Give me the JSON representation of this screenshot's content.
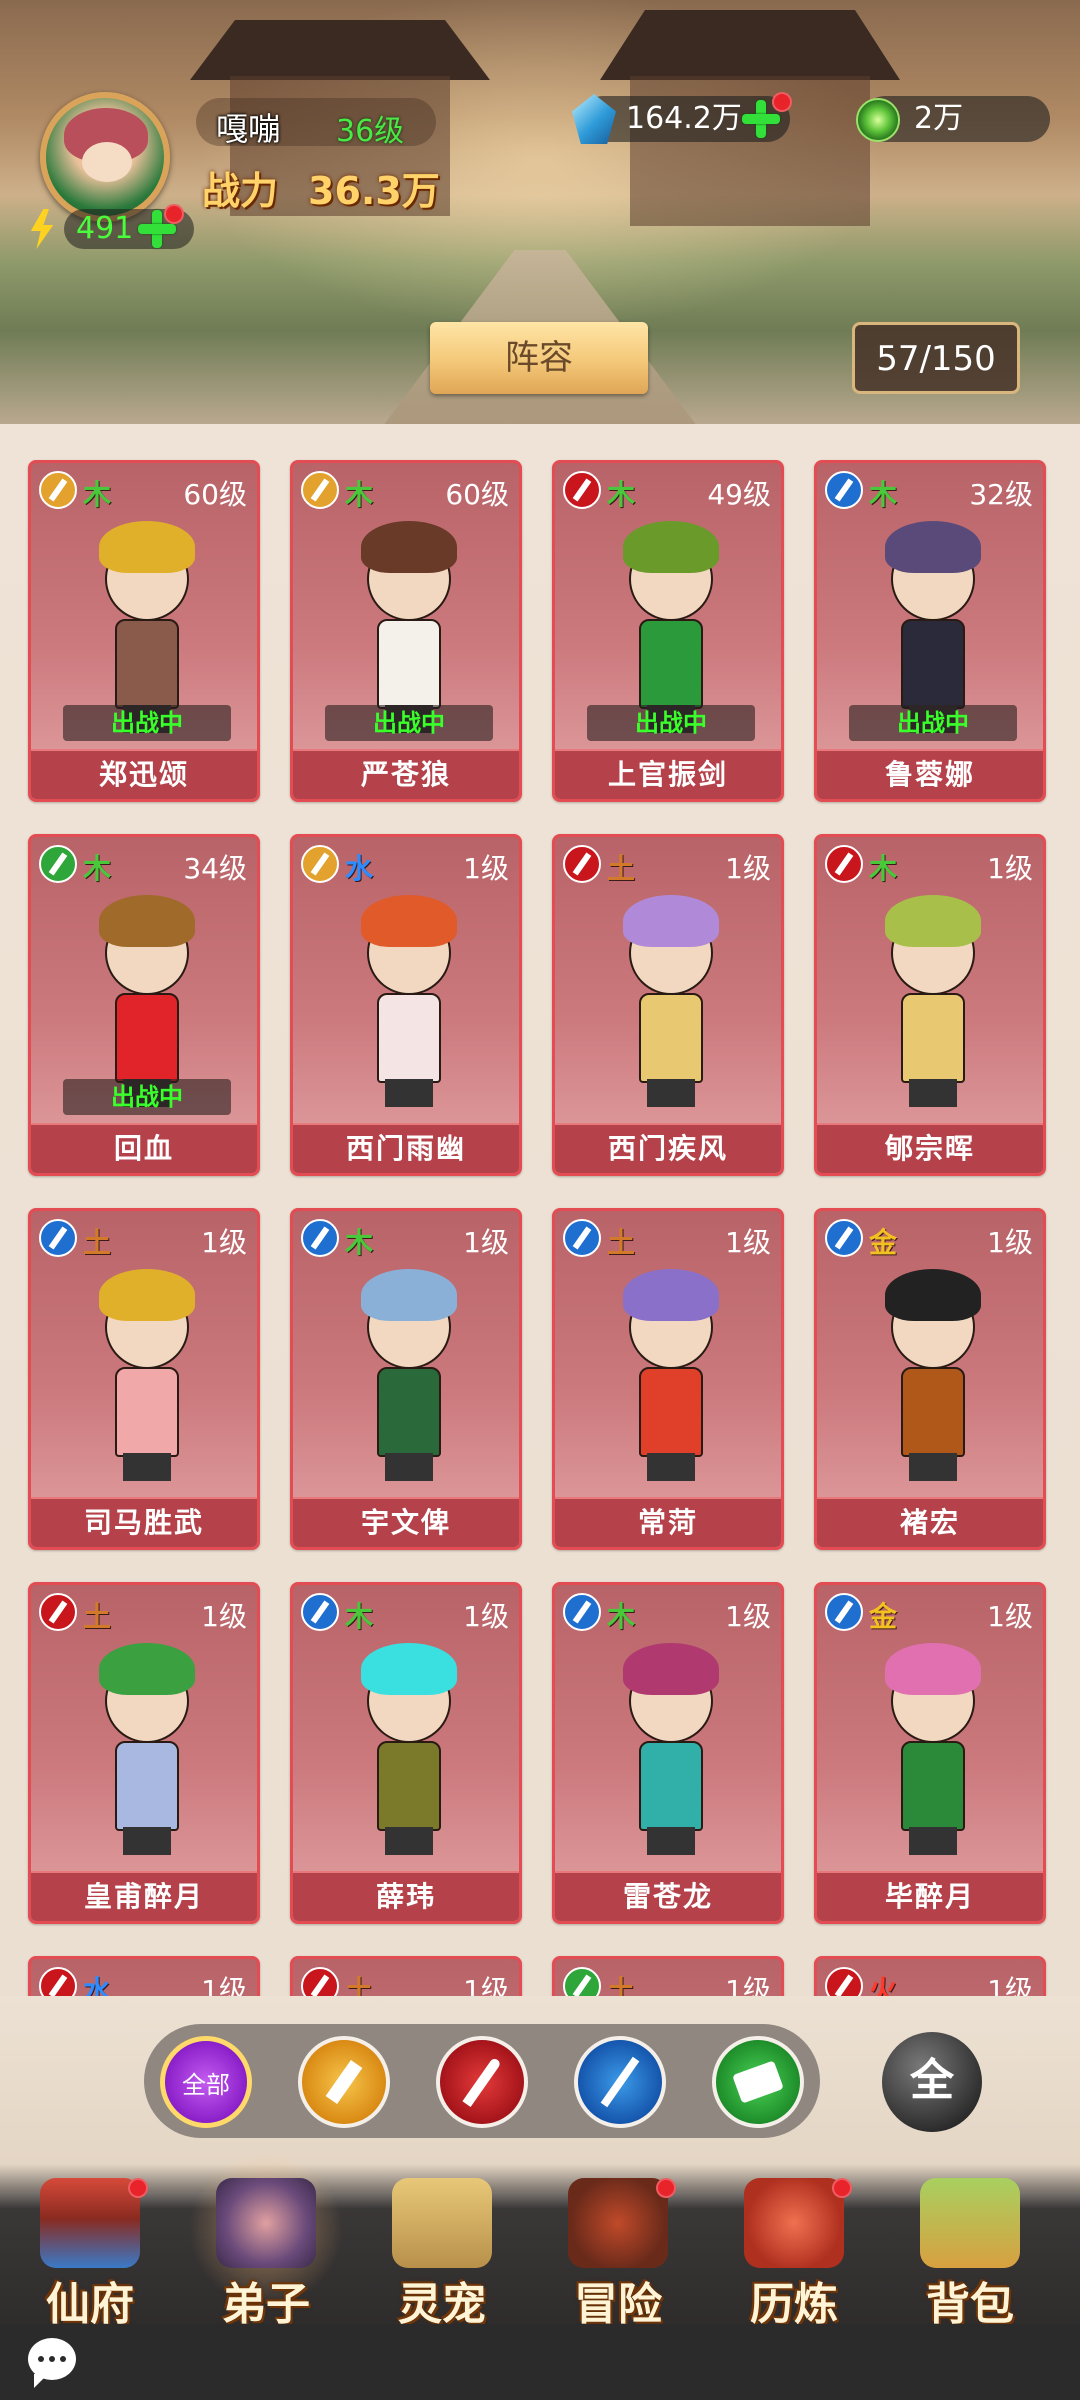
{
  "player": {
    "name": "嘎嘣",
    "level": "36级",
    "power_label": "战力",
    "power_value": "36.3万",
    "energy": "491"
  },
  "resources": {
    "gems": "164.2万",
    "jade": "2万"
  },
  "lineup_button": "阵容",
  "disciple_count": "57/150",
  "deployed_label": "出战中",
  "colors": {
    "card_border": "#e24c52",
    "wood": "#49c83a",
    "water": "#2d8cff",
    "earth": "#d27a2a",
    "gold": "#f2c020",
    "fire": "#ff3a2a",
    "energy_text": "#49ff3c"
  },
  "disciples": [
    {
      "name": "郑迅颂",
      "element": "木",
      "level": "60级",
      "weapon": "axe-icon",
      "deployed": true
    },
    {
      "name": "严苍狼",
      "element": "木",
      "level": "60级",
      "weapon": "axe-icon",
      "deployed": true
    },
    {
      "name": "上官振剑",
      "element": "木",
      "level": "49级",
      "weapon": "sword-icon",
      "deployed": true
    },
    {
      "name": "鲁蓉娜",
      "element": "木",
      "level": "32级",
      "weapon": "staff-icon",
      "deployed": true
    },
    {
      "name": "回血",
      "element": "木",
      "level": "34级",
      "weapon": "fan-icon",
      "deployed": true
    },
    {
      "name": "西门雨幽",
      "element": "水",
      "level": "1级",
      "weapon": "axe-icon",
      "deployed": false
    },
    {
      "name": "西门疾风",
      "element": "土",
      "level": "1级",
      "weapon": "sword-icon",
      "deployed": false
    },
    {
      "name": "郇宗晖",
      "element": "木",
      "level": "1级",
      "weapon": "sword-icon",
      "deployed": false
    },
    {
      "name": "司马胜武",
      "element": "土",
      "level": "1级",
      "weapon": "staff-icon",
      "deployed": false
    },
    {
      "name": "宇文俾",
      "element": "木",
      "level": "1级",
      "weapon": "staff-icon",
      "deployed": false
    },
    {
      "name": "常菏",
      "element": "土",
      "level": "1级",
      "weapon": "staff-icon",
      "deployed": false
    },
    {
      "name": "褚宏",
      "element": "金",
      "level": "1级",
      "weapon": "staff-icon",
      "deployed": false
    },
    {
      "name": "皇甫醉月",
      "element": "土",
      "level": "1级",
      "weapon": "sword-icon",
      "deployed": false
    },
    {
      "name": "薛玮",
      "element": "木",
      "level": "1级",
      "weapon": "staff-icon",
      "deployed": false
    },
    {
      "name": "雷苍龙",
      "element": "木",
      "level": "1级",
      "weapon": "staff-icon",
      "deployed": false
    },
    {
      "name": "毕醉月",
      "element": "金",
      "level": "1级",
      "weapon": "staff-icon",
      "deployed": false
    },
    {
      "name": "",
      "element": "水",
      "level": "1级",
      "weapon": "sword-icon",
      "deployed": false
    },
    {
      "name": "",
      "element": "土",
      "level": "1级",
      "weapon": "sword-icon",
      "deployed": false
    },
    {
      "name": "",
      "element": "土",
      "level": "1级",
      "weapon": "fan-icon",
      "deployed": false
    },
    {
      "name": "",
      "element": "火",
      "level": "1级",
      "weapon": "sword-icon",
      "deployed": false
    }
  ],
  "filters": {
    "all_label": "全部",
    "items": [
      "axe-icon",
      "sword-icon",
      "staff-icon",
      "fan-icon"
    ],
    "element_all_label": "全"
  },
  "nav": [
    {
      "label": "仙府",
      "badge": true,
      "active": false
    },
    {
      "label": "弟子",
      "badge": false,
      "active": true
    },
    {
      "label": "灵宠",
      "badge": false,
      "active": false
    },
    {
      "label": "冒险",
      "badge": true,
      "active": false
    },
    {
      "label": "历炼",
      "badge": true,
      "active": false
    },
    {
      "label": "背包",
      "badge": false,
      "active": false
    }
  ]
}
